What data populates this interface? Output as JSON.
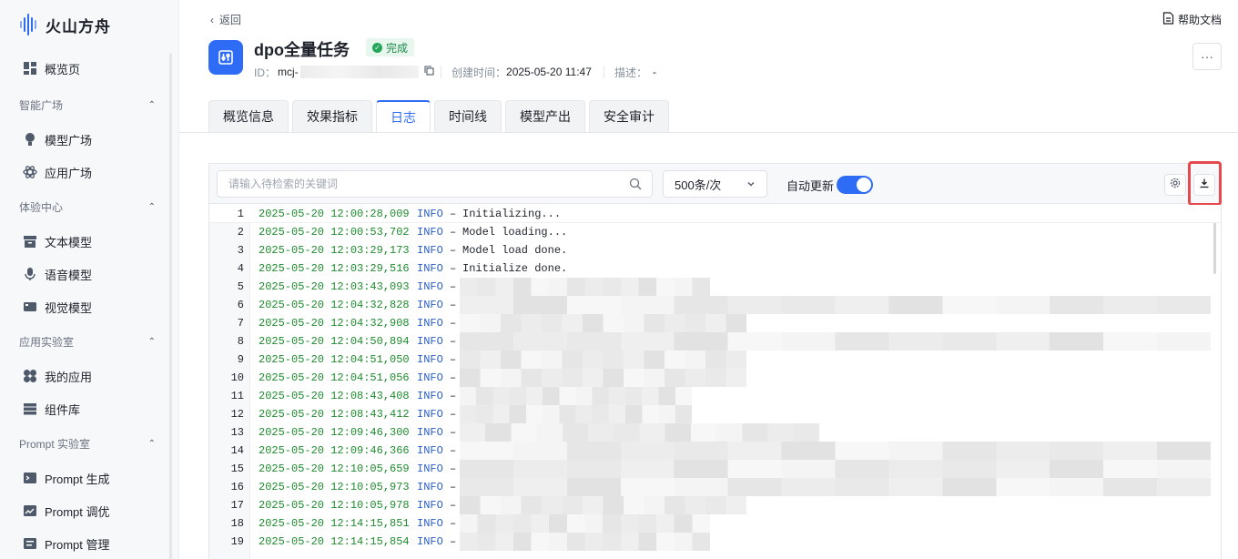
{
  "brand": {
    "name": "火山方舟"
  },
  "sidebar": {
    "overview": "概览页",
    "groups": [
      {
        "label": "智能广场",
        "items": [
          "模型广场",
          "应用广场"
        ]
      },
      {
        "label": "体验中心",
        "items": [
          "文本模型",
          "语音模型",
          "视觉模型"
        ]
      },
      {
        "label": "应用实验室",
        "items": [
          "我的应用",
          "组件库"
        ]
      },
      {
        "label": "Prompt 实验室",
        "items": [
          "Prompt 生成",
          "Prompt 调优",
          "Prompt 管理"
        ]
      }
    ]
  },
  "header": {
    "back": "返回",
    "help": "帮助文档",
    "title": "dpo全量任务",
    "status": "完成",
    "id_label": "ID：",
    "id_prefix": "mcj-",
    "created_label": "创建时间：",
    "created_value": "2025-05-20 11:47",
    "desc_label": "描述：",
    "desc_value": "-",
    "more": "···"
  },
  "tabs": [
    {
      "label": "概览信息",
      "active": false
    },
    {
      "label": "效果指标",
      "active": false
    },
    {
      "label": "日志",
      "active": true
    },
    {
      "label": "时间线",
      "active": false
    },
    {
      "label": "模型产出",
      "active": false
    },
    {
      "label": "安全审计",
      "active": false
    }
  ],
  "log_toolbar": {
    "search_placeholder": "请输入待检索的关键词",
    "page_size": "500条/次",
    "auto_update_label": "自动更新",
    "auto_update_on": true
  },
  "logs": [
    {
      "n": "1",
      "ts": "2025-05-20 12:00:28,009",
      "level": "INFO",
      "msg": "Initializing..."
    },
    {
      "n": "2",
      "ts": "2025-05-20 12:00:53,702",
      "level": "INFO",
      "msg": "Model loading..."
    },
    {
      "n": "3",
      "ts": "2025-05-20 12:03:29,173",
      "level": "INFO",
      "msg": "Model load done."
    },
    {
      "n": "4",
      "ts": "2025-05-20 12:03:29,516",
      "level": "INFO",
      "msg": "Initialize done."
    },
    {
      "n": "5",
      "ts": "2025-05-20 12:03:43,093",
      "level": "INFO",
      "msg": ""
    },
    {
      "n": "6",
      "ts": "2025-05-20 12:04:32,828",
      "level": "INFO",
      "msg": ""
    },
    {
      "n": "7",
      "ts": "2025-05-20 12:04:32,908",
      "level": "INFO",
      "msg": ""
    },
    {
      "n": "8",
      "ts": "2025-05-20 12:04:50,894",
      "level": "INFO",
      "msg": ""
    },
    {
      "n": "9",
      "ts": "2025-05-20 12:04:51,050",
      "level": "INFO",
      "msg": ""
    },
    {
      "n": "10",
      "ts": "2025-05-20 12:04:51,056",
      "level": "INFO",
      "msg": ""
    },
    {
      "n": "11",
      "ts": "2025-05-20 12:08:43,408",
      "level": "INFO",
      "msg": ""
    },
    {
      "n": "12",
      "ts": "2025-05-20 12:08:43,412",
      "level": "INFO",
      "msg": ""
    },
    {
      "n": "13",
      "ts": "2025-05-20 12:09:46,300",
      "level": "INFO",
      "msg": ""
    },
    {
      "n": "14",
      "ts": "2025-05-20 12:09:46,366",
      "level": "INFO",
      "msg": ""
    },
    {
      "n": "15",
      "ts": "2025-05-20 12:10:05,659",
      "level": "INFO",
      "msg": ""
    },
    {
      "n": "16",
      "ts": "2025-05-20 12:10:05,973",
      "level": "INFO",
      "msg": ""
    },
    {
      "n": "17",
      "ts": "2025-05-20 12:10:05,978",
      "level": "INFO",
      "msg": ""
    },
    {
      "n": "18",
      "ts": "2025-05-20 12:14:15,851",
      "level": "INFO",
      "msg": ""
    },
    {
      "n": "19",
      "ts": "2025-05-20 12:14:15,854",
      "level": "INFO",
      "msg": ""
    }
  ],
  "colors": {
    "accent": "#2f6cf6",
    "success": "#23a55a",
    "highlight": "#e5484d",
    "timestamp": "#1e8a2e",
    "level": "#2b5fc9"
  }
}
